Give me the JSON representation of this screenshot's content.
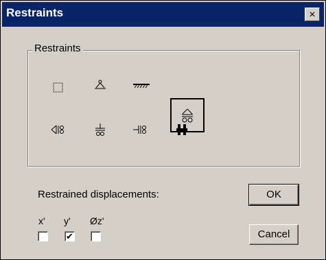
{
  "window": {
    "title": "Restraints",
    "close_glyph": "×"
  },
  "group": {
    "label": "Restraints"
  },
  "restraint_icons": [
    {
      "name": "free-icon"
    },
    {
      "name": "pin-support-icon"
    },
    {
      "name": "fixed-ground-icon"
    },
    {
      "name": "roller-support-icon",
      "selected": true
    },
    {
      "name": "horizontal-roller-icon"
    },
    {
      "name": "vertical-slider-roller-icon"
    },
    {
      "name": "side-slider-icon"
    },
    {
      "name": "clamped-icon"
    }
  ],
  "displacements": {
    "label": "Restrained displacements:",
    "checks": [
      {
        "label": "x'",
        "checked": false
      },
      {
        "label": "y'",
        "checked": true
      },
      {
        "label": "Øz'",
        "checked": false
      }
    ]
  },
  "buttons": {
    "ok": "OK",
    "cancel": "Cancel"
  },
  "colors": {
    "titlebar": "#0a246a",
    "face": "#d4d0c8"
  }
}
